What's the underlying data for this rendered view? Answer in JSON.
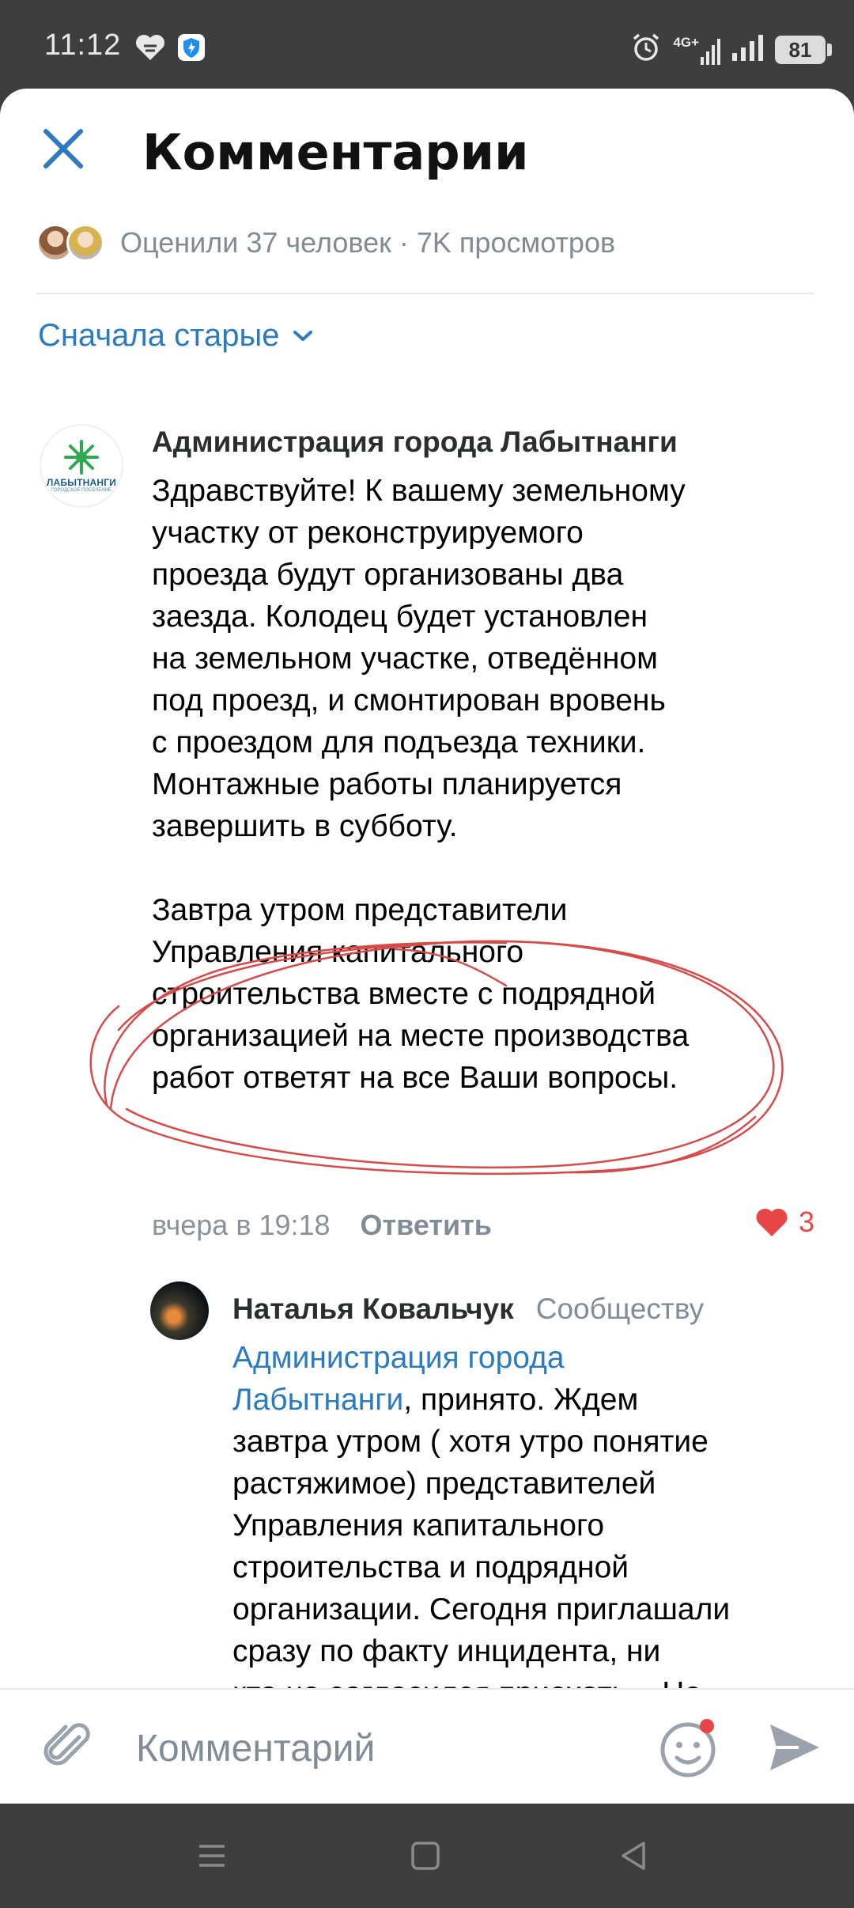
{
  "status_bar": {
    "time": "11:12",
    "network": "4G+",
    "battery": "81"
  },
  "header": {
    "title": "Комментарии"
  },
  "likes_summary": {
    "text": "Оценили 37 человек · 7K просмотров"
  },
  "sort": {
    "label": "Сначала старые"
  },
  "comments": [
    {
      "author": "Администрация города Лабытнанги",
      "avatar_text": "ЛАБЫТНАНГИ",
      "avatar_subtext": "ГОРОДСКОЕ ПОСЕЛЕНИЕ",
      "text": "Здравствуйте! К вашему земельному\nучастку от реконструируемого\nпроезда будут организованы два\nзаезда. Колодец будет установлен\nна земельном участке, отведённом\nпод проезд, и смонтирован вровень\nс проездом для подъезда техники.\nМонтажные работы планируется\nзавершить в субботу.\n\nЗавтра утром представители\nУправления капитального\nстроительства вместе с подрядной\nорганизацией на месте производства\nработ ответят на все Ваши вопросы.",
      "time": "вчера в 19:18",
      "reply_label": "Ответить",
      "likes": "3"
    }
  ],
  "reply": {
    "author": "Наталья Ковальчук",
    "target": "Сообществу",
    "mention": "Администрация города\nЛабытнанги",
    "text": ", принято. Ждем\nзавтра утром ( хотя утро понятие\nрастяжимое) представителей\nУправления капитального\nстроительства и подрядной\nорганизации. Сегодня приглашали\nсразу по факту инцидента, ни\nкто не согласился приехать... Не\nуверены что завтра приедут...."
  },
  "composer": {
    "placeholder": "Комментарий"
  },
  "colors": {
    "accent": "#2a7bc2",
    "like": "#e64646",
    "annotation": "#d84a4a"
  }
}
